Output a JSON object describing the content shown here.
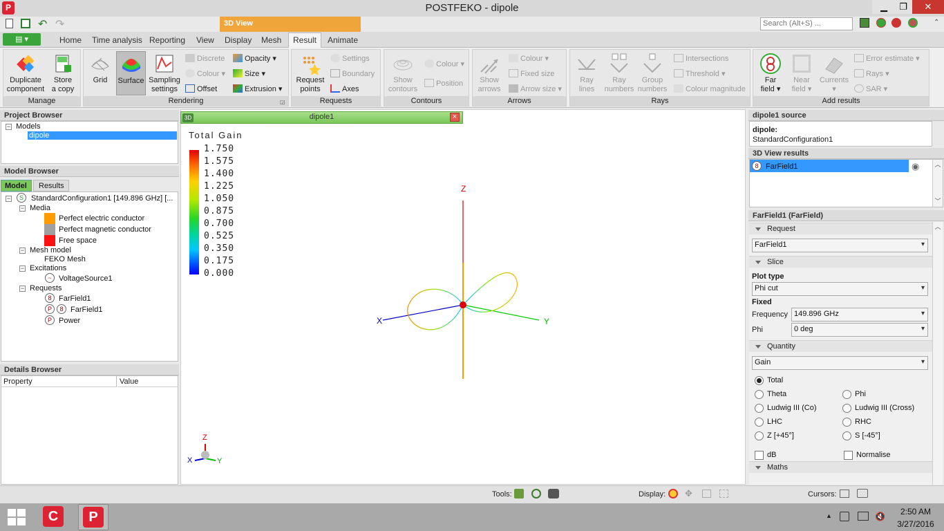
{
  "window": {
    "title": "POSTFEKO - dipole",
    "search_placeholder": "Search (Alt+S) ...",
    "min": "▁",
    "max": "❐",
    "close": "✕"
  },
  "ribbon": {
    "context_tab": "3D View",
    "tabs": [
      "Home",
      "Time analysis",
      "Reporting",
      "View",
      "Display",
      "Mesh",
      "Result",
      "Animate"
    ],
    "groups": {
      "manage": {
        "label": "Manage",
        "duplicate": "Duplicate\ncomponent",
        "store": "Store\na copy"
      },
      "rendering": {
        "label": "Rendering",
        "grid": "Grid",
        "surface": "Surface",
        "sampling": "Sampling\nsettings",
        "discrete": "Discrete",
        "colour": "Colour",
        "offset": "Offset",
        "opacity": "Opacity",
        "size": "Size",
        "extrusion": "Extrusion"
      },
      "requests": {
        "label": "Requests",
        "request_points": "Request\npoints",
        "settings": "Settings",
        "boundary": "Boundary",
        "axes": "Axes"
      },
      "contours": {
        "label": "Contours",
        "show": "Show\ncontours",
        "colour": "Colour",
        "position": "Position"
      },
      "arrows": {
        "label": "Arrows",
        "show": "Show\narrows",
        "colour": "Colour",
        "fixed_size": "Fixed size",
        "arrow_size": "Arrow size"
      },
      "rays": {
        "label": "Rays",
        "ray_lines": "Ray\nlines",
        "ray_numbers": "Ray\nnumbers",
        "group_numbers": "Group\nnumbers",
        "intersections": "Intersections",
        "threshold": "Threshold",
        "colour_magnitude": "Colour magnitude"
      },
      "add_results": {
        "label": "Add results",
        "far_field": "Far\nfield",
        "near_field": "Near\nfield",
        "currents": "Currents",
        "error_estimate": "Error estimate",
        "rays": "Rays",
        "sar": "SAR"
      }
    }
  },
  "project_browser": {
    "title": "Project Browser",
    "models": "Models",
    "dipole": "dipole"
  },
  "model_browser": {
    "title": "Model Browser",
    "tab_model": "Model",
    "tab_results": "Results",
    "config": "StandardConfiguration1 [149.896 GHz] [...",
    "media": "Media",
    "pec": "Perfect electric conductor",
    "pmc": "Perfect magnetic conductor",
    "free_space": "Free space",
    "mesh_model": "Mesh model",
    "feko_mesh": "FEKO Mesh",
    "excitations": "Excitations",
    "voltage_source": "VoltageSource1",
    "requests": "Requests",
    "farfield_a": "FarField1",
    "farfield_b": "FarField1",
    "power": "Power"
  },
  "details_browser": {
    "title": "Details Browser",
    "col_property": "Property",
    "col_value": "Value"
  },
  "viewport": {
    "tab": "dipole1",
    "legend_title": "Total Gain",
    "legend_values": [
      "1.750",
      "1.575",
      "1.400",
      "1.225",
      "1.050",
      "0.875",
      "0.700",
      "0.525",
      "0.350",
      "0.175",
      "0.000"
    ],
    "axis_z": "Z",
    "axis_x": "X",
    "axis_y": "Y",
    "triad_z": "Z",
    "triad_x": "X",
    "triad_y": "Y"
  },
  "right_panel": {
    "source_title": "dipole1 source",
    "source_name": "dipole:",
    "source_config": "StandardConfiguration1",
    "results_title": "3D View results",
    "result_item": "FarField1",
    "ff_title": "FarField1 (FarField)",
    "sec_request": "Request",
    "request_value": "FarField1",
    "sec_slice": "Slice",
    "plot_type_label": "Plot type",
    "plot_type_value": "Phi cut",
    "fixed_label": "Fixed",
    "frequency_label": "Frequency",
    "frequency_value": "149.896 GHz",
    "phi_label": "Phi",
    "phi_value": "0 deg",
    "sec_quantity": "Quantity",
    "quantity_value": "Gain",
    "radios": {
      "total": "Total",
      "theta": "Theta",
      "phi": "Phi",
      "lud_co": "Ludwig III (Co)",
      "lud_cross": "Ludwig III (Cross)",
      "lhc": "LHC",
      "rhc": "RHC",
      "z45": "Z [+45°]",
      "s45": "S [-45°]"
    },
    "db": "dB",
    "normalise": "Normalise",
    "sec_maths": "Maths"
  },
  "status": {
    "tools": "Tools:",
    "display": "Display:",
    "cursors": "Cursors:"
  },
  "taskbar": {
    "time": "2:50 AM",
    "date": "3/27/2016"
  },
  "colors": {
    "accent_green": "#3aa53a",
    "context_orange": "#f0a53a",
    "selection_blue": "#3399ff"
  }
}
